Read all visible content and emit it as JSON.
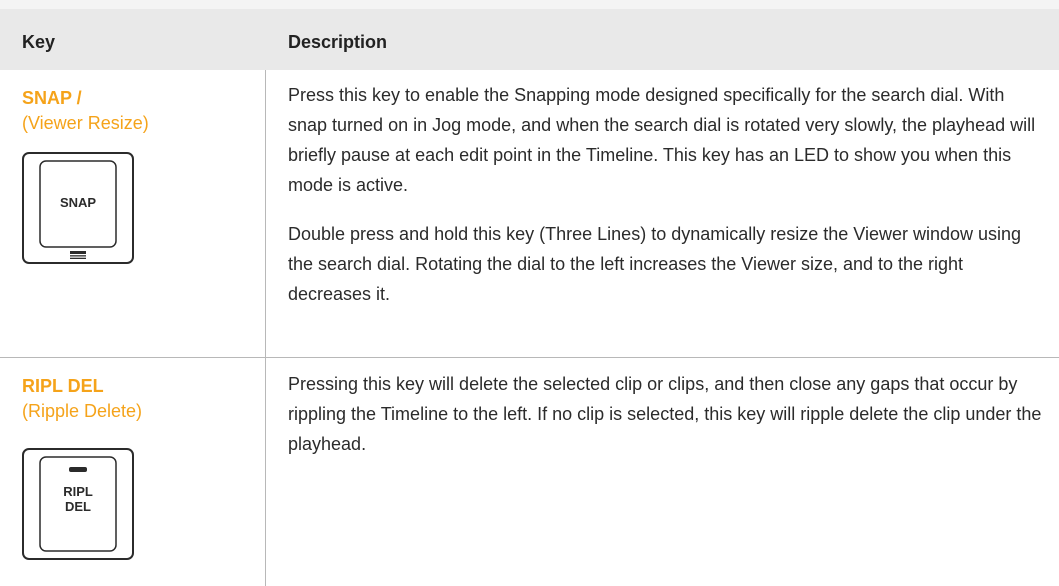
{
  "header": {
    "key": "Key",
    "description": "Description"
  },
  "rows": [
    {
      "key_name": "SNAP /",
      "key_sub": "(Viewer Resize)",
      "keycap_label": "SNAP",
      "paragraphs": [
        "Press this key to enable the Snapping mode designed specifically for the search dial. With snap turned on in Jog mode, and when the search dial is rotated very slowly, the playhead will briefly pause at each edit point in the Timeline. This key has an LED to show you when this mode is active.",
        "Double press and hold this key (Three Lines) to dynamically resize the Viewer window using the search dial. Rotating the dial to the left increases the Viewer size, and to the right decreases it."
      ]
    },
    {
      "key_name": "RIPL DEL",
      "key_sub": "(Ripple Delete)",
      "keycap_label_line1": "RIPL",
      "keycap_label_line2": "DEL",
      "paragraphs": [
        "Pressing this key will delete the selected clip or clips, and then close any gaps that occur by rippling the Timeline to the left. If no clip is selected, this key will ripple delete the clip under the playhead."
      ]
    }
  ],
  "colors": {
    "accent": "#f5a31a",
    "header_bg": "#e9e9e9",
    "text": "#2b2b2b",
    "rule": "#b8b8b8"
  }
}
